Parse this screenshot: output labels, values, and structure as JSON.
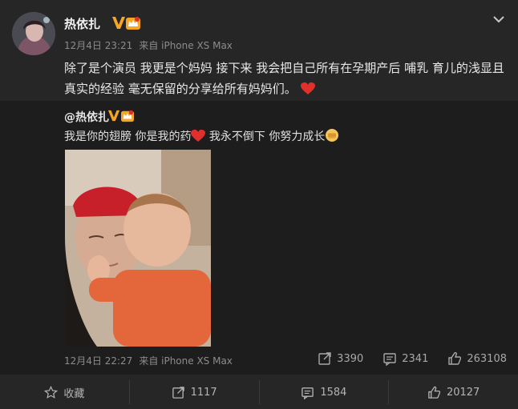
{
  "post": {
    "author": "热依扎",
    "timestamp": "12月4日 23:21",
    "source": "来自 iPhone XS Max",
    "text": "除了是个演员 我更是个妈妈 接下来 我会把自己所有在孕期产后 哺乳 育儿的浅显且真实的经验 毫无保留的分享给所有妈妈们。",
    "icons": [
      "verified-v-icon",
      "crown-badge-icon",
      "chevron-down-icon",
      "heart-emoji"
    ]
  },
  "repost": {
    "mention": "@热依扎",
    "text_part1": "我是你的翅膀 你是我的药",
    "text_part2": " 我永不倒下 你努力成长",
    "icons": [
      "heart-emoji",
      "fist-emoji"
    ],
    "timestamp": "12月4日 22:27",
    "source": "来自 iPhone XS Max",
    "stats": {
      "reposts": "3390",
      "comments": "2341",
      "likes": "263108"
    }
  },
  "footer": {
    "favorite_label": "收藏",
    "reposts": "1117",
    "comments": "1584",
    "likes": "20127"
  },
  "colors": {
    "background": "#262626",
    "repost_background": "#1d1d1d",
    "verified_orange": "#f6a623",
    "heart_red": "#e0302c"
  }
}
